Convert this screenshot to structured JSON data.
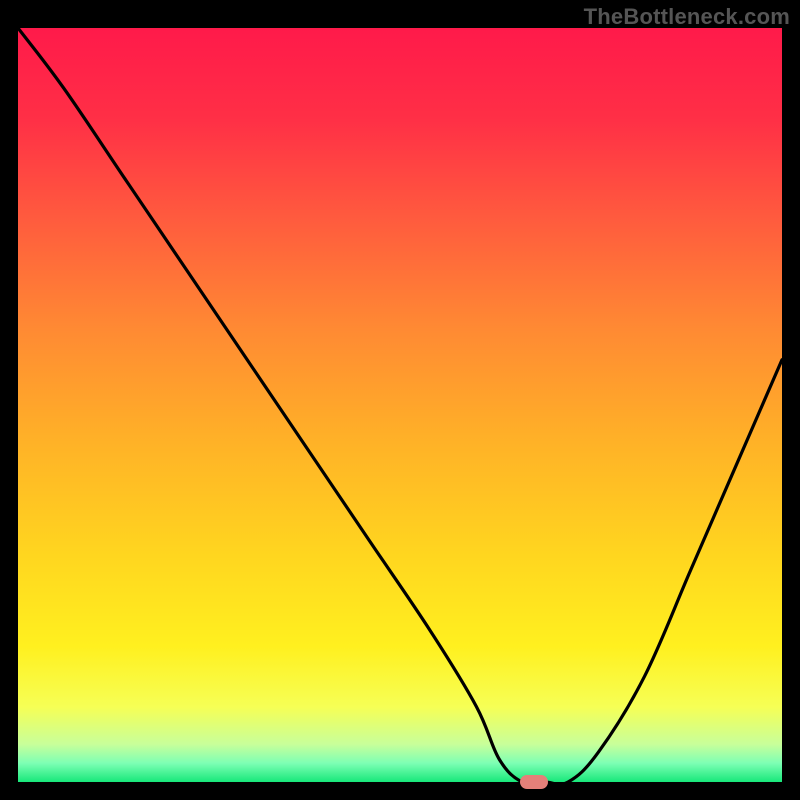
{
  "watermark": "TheBottleneck.com",
  "marker": {
    "color": "#e48079"
  },
  "gradient_stops": [
    {
      "offset": 0.0,
      "color": "#ff1a4a"
    },
    {
      "offset": 0.12,
      "color": "#ff2f46"
    },
    {
      "offset": 0.25,
      "color": "#ff5a3e"
    },
    {
      "offset": 0.4,
      "color": "#ff8a33"
    },
    {
      "offset": 0.55,
      "color": "#ffb227"
    },
    {
      "offset": 0.7,
      "color": "#ffd61f"
    },
    {
      "offset": 0.82,
      "color": "#fff01f"
    },
    {
      "offset": 0.9,
      "color": "#f6ff55"
    },
    {
      "offset": 0.95,
      "color": "#c8ff9a"
    },
    {
      "offset": 0.975,
      "color": "#7dffb4"
    },
    {
      "offset": 1.0,
      "color": "#18e87a"
    }
  ],
  "chart_data": {
    "type": "line",
    "title": "",
    "xlabel": "",
    "ylabel": "",
    "xlim": [
      0,
      100
    ],
    "ylim": [
      0,
      100
    ],
    "series": [
      {
        "name": "bottleneck-curve",
        "x": [
          0,
          6,
          14,
          22,
          30,
          38,
          46,
          54,
          60,
          63,
          66,
          69,
          72,
          76,
          82,
          88,
          94,
          100
        ],
        "y": [
          100,
          92,
          80,
          68,
          56,
          44,
          32,
          20,
          10,
          3,
          0,
          0,
          0,
          4,
          14,
          28,
          42,
          56
        ]
      }
    ],
    "annotation": {
      "name": "highlight-marker",
      "x": 67.5,
      "y": 0
    }
  }
}
